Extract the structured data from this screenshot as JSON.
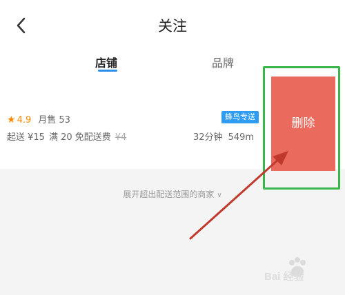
{
  "header": {
    "title": "关注"
  },
  "tabs": [
    {
      "label": "店铺",
      "active": true
    },
    {
      "label": "品牌",
      "active": false
    }
  ],
  "shop": {
    "star_icon": "star-icon",
    "rating": "4.9",
    "monthly_sales": "月售 53",
    "min_order": "起送 ¥15",
    "free_delivery": "满 20 免配送费",
    "delivery_fee_original": "¥4",
    "delivery_badge": "蜂鸟专送",
    "delivery_time": "32分钟",
    "distance": "549m"
  },
  "actions": {
    "delete_label": "删除"
  },
  "expand": {
    "label": "展开超出配送范围的商家"
  },
  "watermark": {
    "text": "Bai 经验"
  },
  "colors": {
    "accent_blue": "#2f8fe8",
    "delete_red": "#ea6b5e",
    "highlight_green": "#3ab54a",
    "arrow_red": "#c0392b",
    "rating_orange": "#ff8a00"
  }
}
